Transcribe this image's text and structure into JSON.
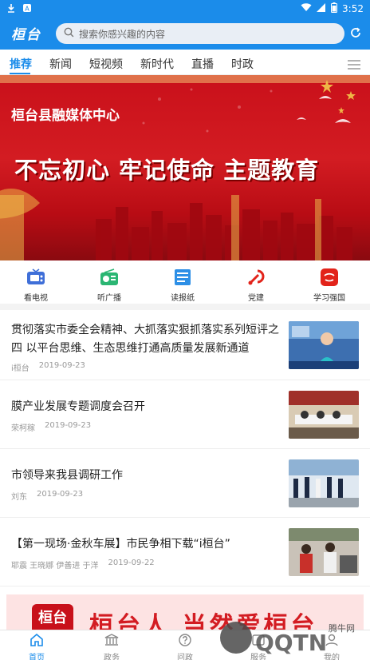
{
  "status_bar": {
    "time": "3:52"
  },
  "app": {
    "logo": "桓台"
  },
  "search": {
    "placeholder": "搜索你感兴趣的内容"
  },
  "tabs": [
    "推荐",
    "新闻",
    "短视频",
    "新时代",
    "直播",
    "时政"
  ],
  "banner": {
    "org": "桓台县融媒体中心",
    "slogan": "不忘初心  牢记使命  主题教育"
  },
  "quick_links": [
    {
      "label": "看电视",
      "icon": "tv-icon",
      "color": "#3f6fd8"
    },
    {
      "label": "听广播",
      "icon": "radio-icon",
      "color": "#2bb673"
    },
    {
      "label": "读报纸",
      "icon": "newspaper-icon",
      "color": "#2d8fe6"
    },
    {
      "label": "党建",
      "icon": "party-emblem-icon",
      "color": "#e2231a"
    },
    {
      "label": "学习强国",
      "icon": "xuexi-qiangguo-icon",
      "color": "#e2231a"
    }
  ],
  "news": [
    {
      "title": "贯彻落实市委全会精神、大抓落实狠抓落实系列短评之四 以平台思维、生态思维打通高质量发展新通道",
      "source": "i桓台",
      "date": "2019-09-23"
    },
    {
      "title": "膜产业发展专题调度会召开",
      "source": "荣柯稼",
      "date": "2019-09-23"
    },
    {
      "title": "市领导来我县调研工作",
      "source": "刘东",
      "date": "2019-09-23"
    },
    {
      "title": "【第一现场·金秋车展】市民争相下载“i桓台”",
      "source": "耶震 王晓娜 伊善进 于洋",
      "date": "2019-09-22"
    }
  ],
  "ad_banner": {
    "logo_text": "桓台",
    "text": "桓台人  当然爱桓台"
  },
  "bottom_nav": [
    "首页",
    "政务",
    "问政",
    "服务",
    "我的"
  ],
  "watermark": {
    "text": "QQTN",
    "sub": "腾牛网"
  },
  "colors": {
    "primary": "#1b8cea",
    "banner_red": "#d31c22"
  }
}
